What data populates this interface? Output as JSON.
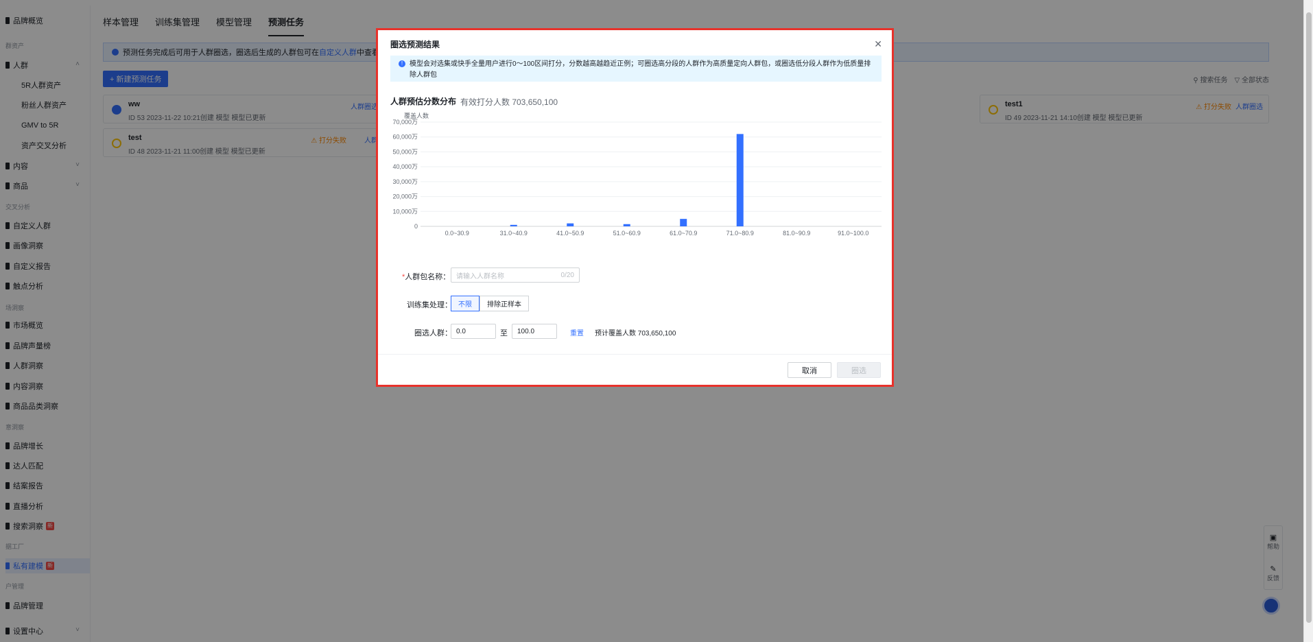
{
  "sidebar": {
    "items": [
      {
        "label": "品牌概览",
        "top": 30
      },
      {
        "label": "人群",
        "top": 95,
        "chev": "^"
      },
      {
        "label": "5R人群资产",
        "top": 124,
        "sub": true
      },
      {
        "label": "粉丝人群资产",
        "top": 153,
        "sub": true
      },
      {
        "label": "GMV to 5R",
        "top": 183,
        "sub": true
      },
      {
        "label": "资产交叉分析",
        "top": 212,
        "sub": true
      },
      {
        "label": "内容",
        "top": 242,
        "chev": "v"
      },
      {
        "label": "商品",
        "top": 271,
        "chev": "v"
      },
      {
        "label": "自定义人群",
        "top": 329
      },
      {
        "label": "画像洞察",
        "top": 358
      },
      {
        "label": "自定义报告",
        "top": 388
      },
      {
        "label": "触点分析",
        "top": 417
      },
      {
        "label": "市场概览",
        "top": 474
      },
      {
        "label": "品牌声量榜",
        "top": 504
      },
      {
        "label": "人群洞察",
        "top": 533
      },
      {
        "label": "内容洞察",
        "top": 563
      },
      {
        "label": "商品品类洞察",
        "top": 592
      },
      {
        "label": "品牌增长",
        "top": 650
      },
      {
        "label": "达人匹配",
        "top": 679
      },
      {
        "label": "结案报告",
        "top": 708
      },
      {
        "label": "直播分析",
        "top": 738
      },
      {
        "label": "搜索洞察",
        "top": 767,
        "badge": "新"
      },
      {
        "label": "私有建模",
        "top": 825,
        "badge": "新",
        "active": true
      },
      {
        "label": "品牌管理",
        "top": 883
      },
      {
        "label": "设置中心",
        "top": 920,
        "chev": "v"
      }
    ],
    "groups": [
      {
        "label": "群资产",
        "top": 66
      },
      {
        "label": "交叉分析",
        "top": 301
      },
      {
        "label": "场洞察",
        "top": 448
      },
      {
        "label": "意洞察",
        "top": 622
      },
      {
        "label": "据工厂",
        "top": 796
      },
      {
        "label": "户管理",
        "top": 854
      }
    ]
  },
  "tabs": [
    {
      "label": "样本管理",
      "active": false
    },
    {
      "label": "训练集管理",
      "active": false
    },
    {
      "label": "模型管理",
      "active": false
    },
    {
      "label": "预测任务",
      "active": true
    }
  ],
  "info_bar": {
    "text": "预测任务完成后可用于人群圈选，圈选后生成的人群包可在",
    "link": "自定义人群",
    "suffix": "中查看"
  },
  "new_task_label": "+ 新建预测任务",
  "filters": {
    "search": "搜索任务",
    "status": "全部状态"
  },
  "cards": [
    {
      "title": "ww",
      "meta": "ID 53   2023-11-22 10:21创建   模型 模型已更新",
      "dot": "#3370ff",
      "act": "人群圈选"
    },
    {
      "title": "test",
      "meta": "ID 48   2023-11-21 11:00创建   模型 模型已更新",
      "dot": "#ffc60a",
      "warn": "⚠ 打分失败",
      "act": "人群"
    },
    {
      "title": "test1",
      "meta": "ID 49   2023-11-21 14:10创建   模型 模型已更新",
      "dot": "#ffc60a",
      "warn": "⚠ 打分失败",
      "act": "人群圈选"
    }
  ],
  "float_tools": {
    "help": "帮助",
    "feedback": "反馈"
  },
  "modal": {
    "title": "圈选预测结果",
    "tip": "模型会对选集或快手全量用户进行0～100区间打分，分数越高越趋近正例；可圈选高分段的人群作为高质量定向人群包，或圈选低分段人群作为低质量排除人群包",
    "dist_title": "人群预估分数分布",
    "dist_sub": "有效打分人数 703,650,100",
    "name_label": "人群包名称",
    "name_placeholder": "请输入人群名称",
    "name_counter": "0/20",
    "train_label": "训练集处理",
    "train_options": [
      "不限",
      "排除正样本"
    ],
    "select_label": "圈选人群",
    "range_from": "0.0",
    "range_to": "100.0",
    "range_sep": "至",
    "reset": "重置",
    "estimate": "预计覆盖人数  703,650,100",
    "cancel": "取消",
    "confirm": "圈选"
  },
  "chart_data": {
    "type": "bar",
    "ylabel": "覆盖人数",
    "categories": [
      "0.0~30.9",
      "31.0~40.9",
      "41.0~50.9",
      "51.0~60.9",
      "61.0~70.9",
      "71.0~80.9",
      "81.0~90.9",
      "91.0~100.0"
    ],
    "values": [
      0,
      1000,
      2000,
      1500,
      5000,
      62000,
      0,
      0
    ],
    "yticks": [
      "0",
      "10,000万",
      "20,000万",
      "30,000万",
      "40,000万",
      "50,000万",
      "60,000万",
      "70,000万"
    ],
    "ylim": [
      0,
      70000
    ],
    "unit": "万",
    "color": "#3370ff"
  }
}
